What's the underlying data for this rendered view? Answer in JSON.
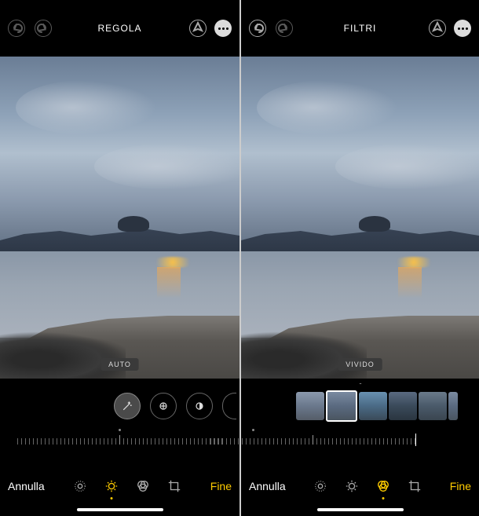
{
  "panes": [
    {
      "title": "REGOLA",
      "badge": "AUTO",
      "cancel": "Annulla",
      "done": "Fine",
      "active_tab": "adjust",
      "tools": [
        "auto-wand",
        "exposure",
        "brilliance"
      ]
    },
    {
      "title": "FILTRI",
      "badge": "VIVIDO",
      "cancel": "Annulla",
      "done": "Fine",
      "active_tab": "filters",
      "selected_filter_index": 1,
      "filter_count": 6
    }
  ],
  "icons": {
    "undo": "undo-icon",
    "redo": "redo-icon",
    "markup": "markup-icon",
    "more": "more-icon"
  }
}
